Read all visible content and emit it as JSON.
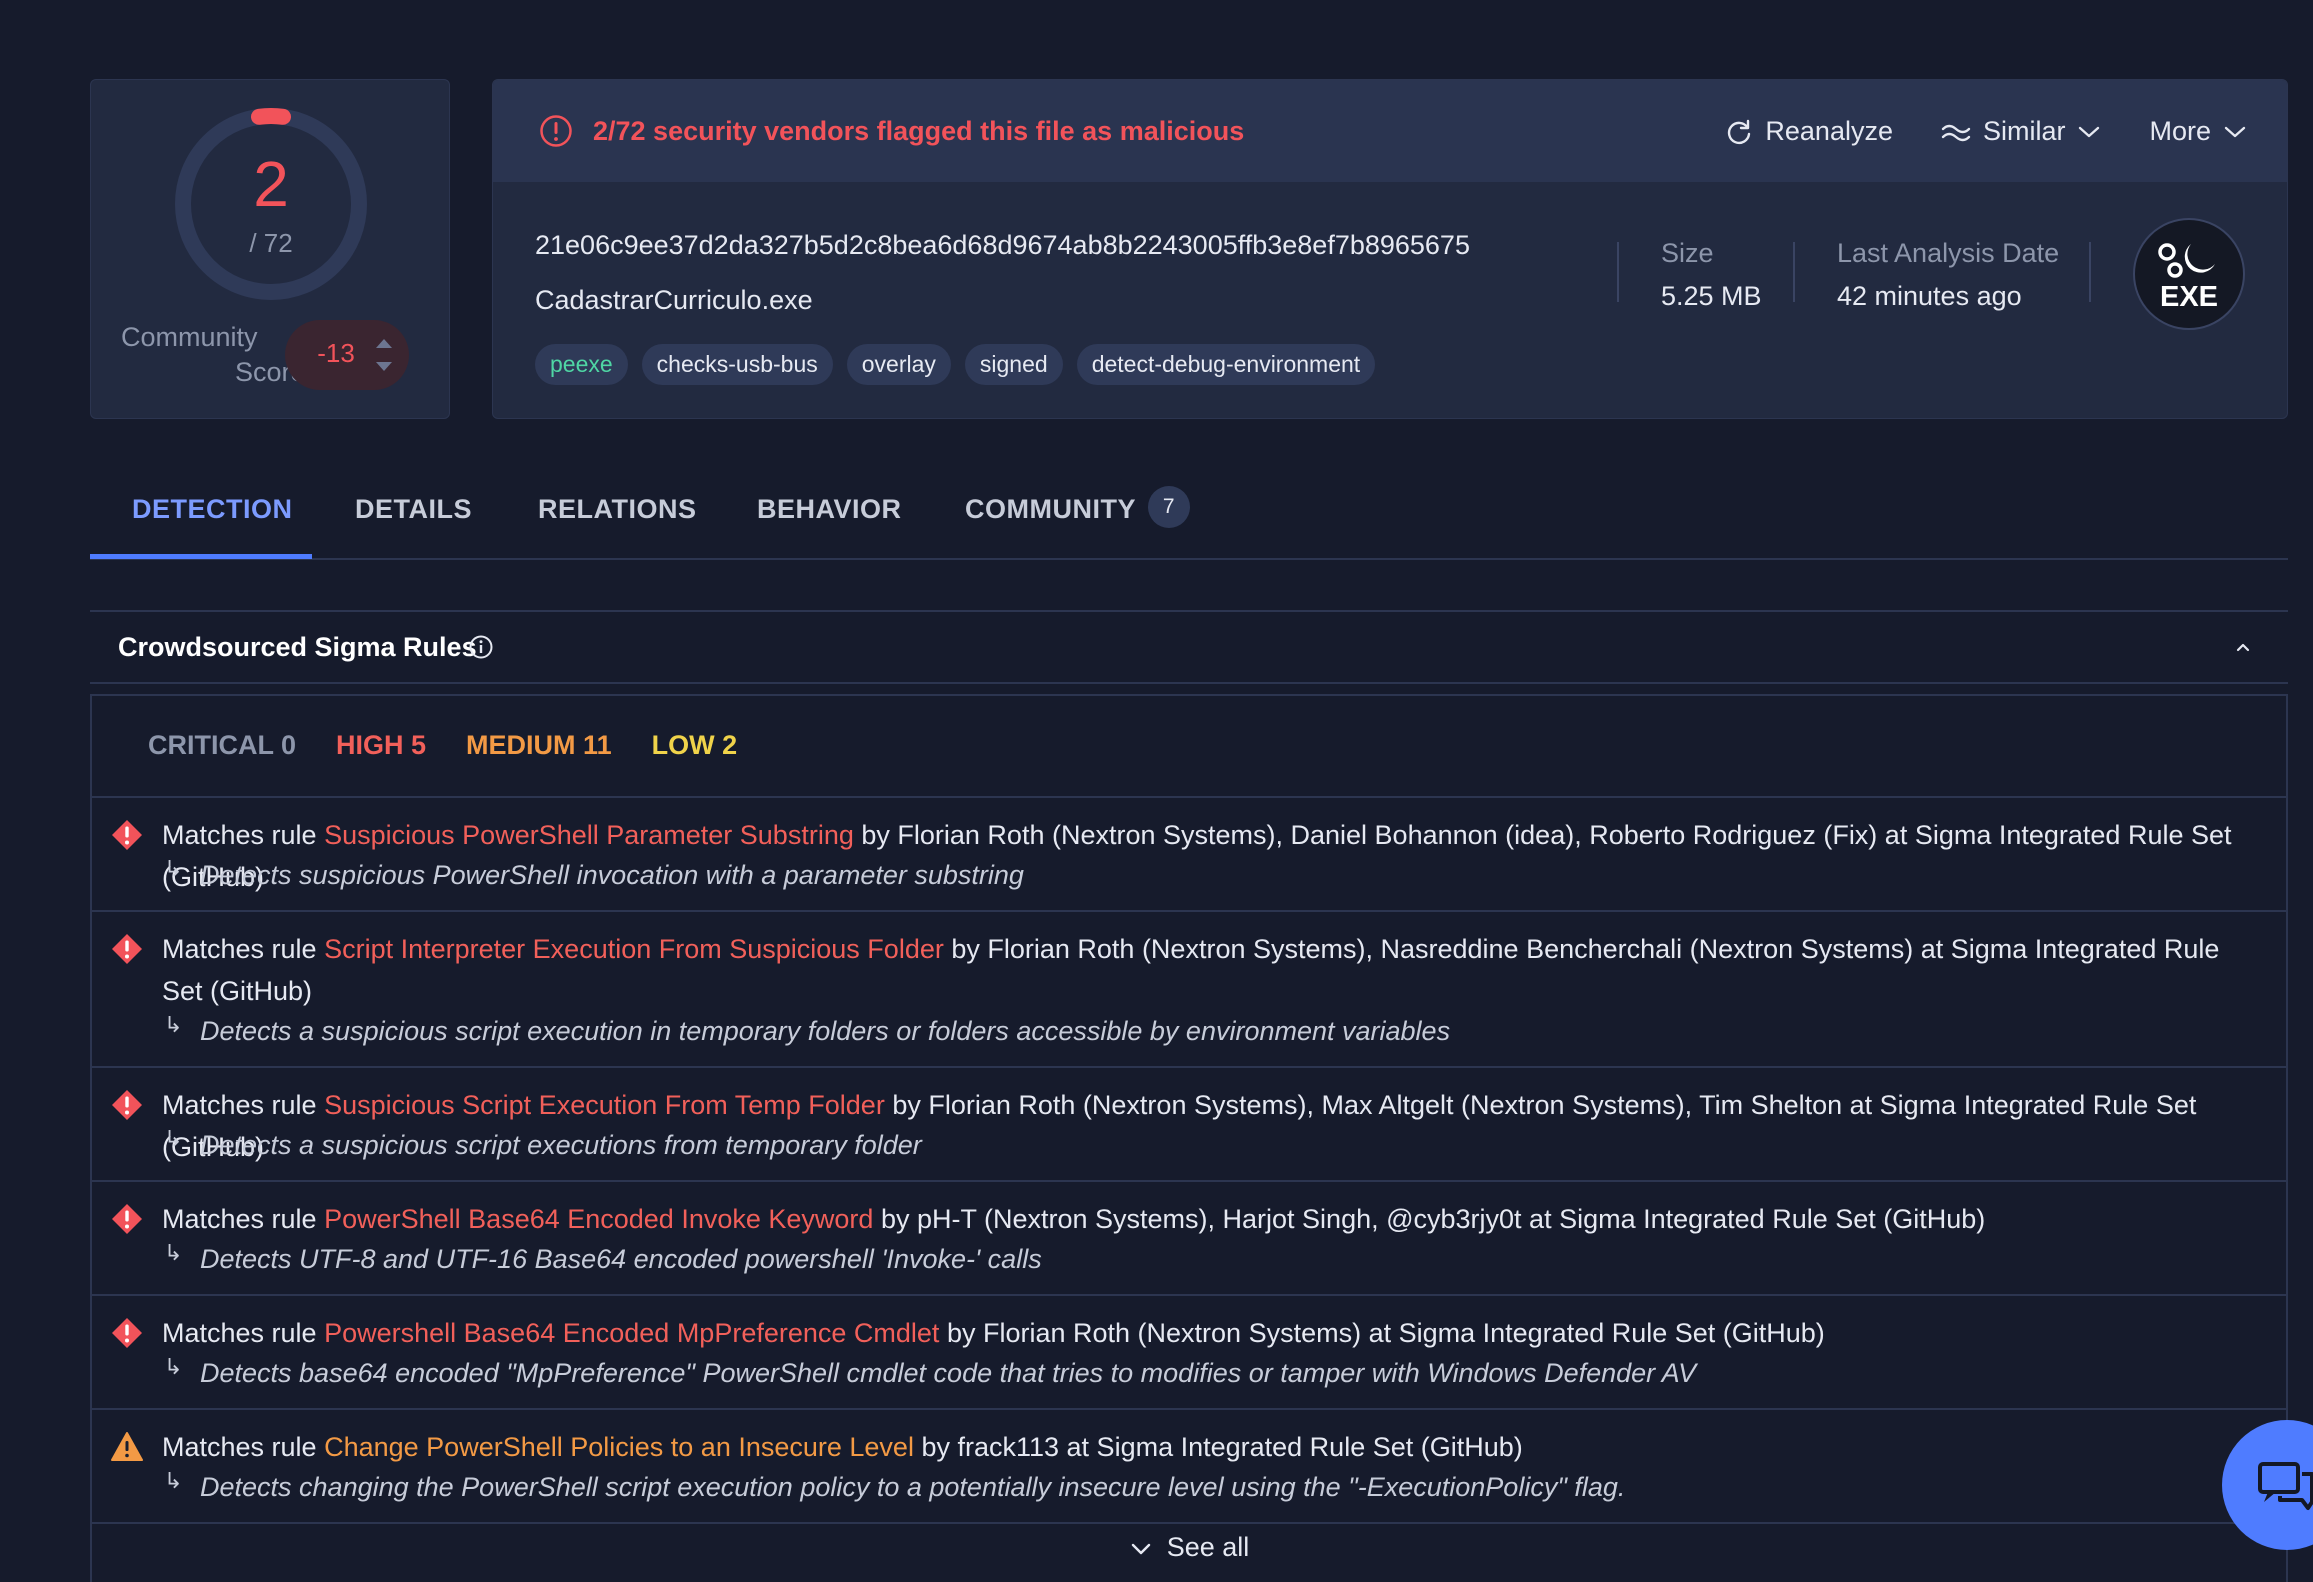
{
  "score": {
    "detections": "2",
    "total": "/ 72",
    "community_label_1": "Community",
    "community_label_2": "Score",
    "community_value": "-13",
    "accent": "#f2535a"
  },
  "banner": {
    "alert_text": "2/72 security vendors flagged this file as malicious",
    "reanalyze": "Reanalyze",
    "similar": "Similar",
    "more": "More",
    "alert_icon": "alert-circle-icon",
    "reanalyze_icon": "refresh-icon",
    "similar_icon": "similar-waves-icon"
  },
  "file": {
    "hash": "21e06c9ee37d2da327b5d2c8bea6d68d9674ab8b2243005ffb3e8ef7b8965675",
    "name": "CadastrarCurriculo.exe",
    "tags": [
      "peexe",
      "checks-usb-bus",
      "overlay",
      "signed",
      "detect-debug-environment"
    ],
    "size_label": "Size",
    "size_value": "5.25 MB",
    "date_label": "Last Analysis Date",
    "date_value": "42 minutes ago",
    "type_badge": "EXE"
  },
  "tabs": [
    {
      "label": "DETECTION",
      "active": true
    },
    {
      "label": "DETAILS"
    },
    {
      "label": "RELATIONS"
    },
    {
      "label": "BEHAVIOR"
    },
    {
      "label": "COMMUNITY",
      "badge": "7"
    }
  ],
  "sigma": {
    "title": "Crowdsourced Sigma Rules",
    "severities": {
      "critical": "CRITICAL 0",
      "high": "HIGH 5",
      "medium": "MEDIUM 11",
      "low": "LOW 2"
    },
    "prefix": "Matches rule",
    "rules": [
      {
        "severity": "high",
        "name": "Suspicious PowerShell Parameter Substring",
        "by": "by Florian Roth (Nextron Systems), Daniel Bohannon (idea), Roberto Rodriguez (Fix) at Sigma Integrated Rule Set (GitHub)",
        "desc": "Detects suspicious PowerShell invocation with a parameter substring"
      },
      {
        "severity": "high",
        "name": "Script Interpreter Execution From Suspicious Folder",
        "by": "by Florian Roth (Nextron Systems), Nasreddine Bencherchali (Nextron Systems) at Sigma Integrated Rule Set (GitHub)",
        "desc": "Detects a suspicious script execution in temporary folders or folders accessible by environment variables"
      },
      {
        "severity": "high",
        "name": "Suspicious Script Execution From Temp Folder",
        "by": "by Florian Roth (Nextron Systems), Max Altgelt (Nextron Systems), Tim Shelton at Sigma Integrated Rule Set (GitHub)",
        "desc": "Detects a suspicious script executions from temporary folder"
      },
      {
        "severity": "high",
        "name": "PowerShell Base64 Encoded Invoke Keyword",
        "by": "by pH-T (Nextron Systems), Harjot Singh, @cyb3rjy0t at Sigma Integrated Rule Set (GitHub)",
        "desc": "Detects UTF-8 and UTF-16 Base64 encoded powershell 'Invoke-' calls"
      },
      {
        "severity": "high",
        "name": "Powershell Base64 Encoded MpPreference Cmdlet",
        "by": "by Florian Roth (Nextron Systems) at Sigma Integrated Rule Set (GitHub)",
        "desc": "Detects base64 encoded \"MpPreference\" PowerShell cmdlet code that tries to modifies or tamper with Windows Defender AV"
      },
      {
        "severity": "medium",
        "name": "Change PowerShell Policies to an Insecure Level",
        "by": "by frack113 at Sigma Integrated Rule Set (GitHub)",
        "desc": "Detects changing the PowerShell script execution policy to a potentially insecure level using the \"-ExecutionPolicy\" flag."
      }
    ],
    "see_all": "See all",
    "colors": {
      "high": "#f2535a",
      "medium": "#f39a45"
    }
  }
}
